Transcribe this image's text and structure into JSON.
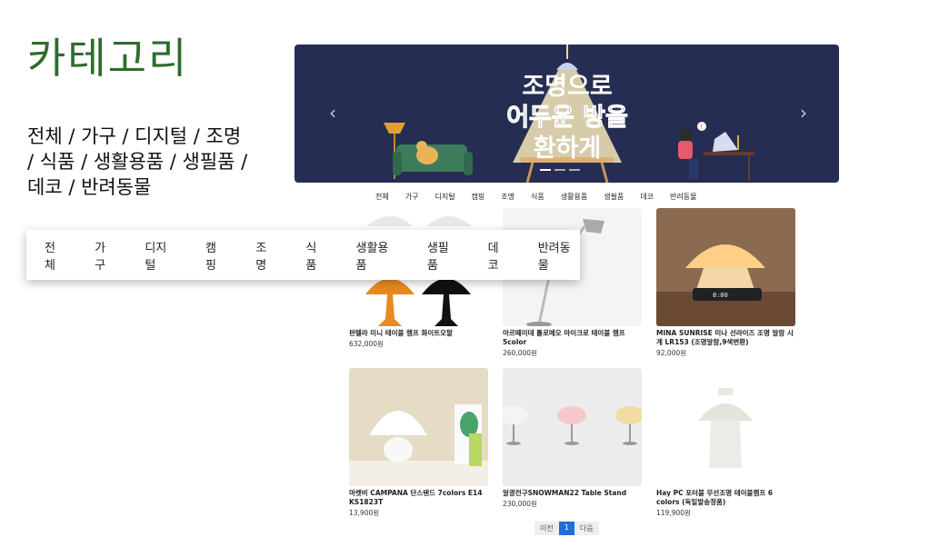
{
  "page_title": "카테고리",
  "category_text": [
    "전체 / 가구 / 디지털 / 조명",
    "/ 식품 / 생활용품 / 생필품 /",
    "데코 / 반려동물"
  ],
  "banner": {
    "line1": "조명으로",
    "line2": "어두운 방을",
    "line3": "환하게",
    "prev_icon": "chevron-left-icon",
    "next_icon": "chevron-right-icon",
    "bg_color": "#262d52"
  },
  "small_categories": [
    "전체",
    "가구",
    "디지털",
    "캠핑",
    "조명",
    "식품",
    "생활용품",
    "생필품",
    "데코",
    "반려동물"
  ],
  "category_bar": [
    "전체",
    "가구",
    "디지털",
    "캠핑",
    "조명",
    "식품",
    "생활용품",
    "생필품",
    "데코",
    "반려동물"
  ],
  "products": [
    {
      "name": "판텔라 미니 테이블 램프 화이트오팔",
      "price": "632,000원"
    },
    {
      "name": "아르떼미데 톨로메오 마이크로 테이블 램프 5color",
      "price": "260,000원"
    },
    {
      "name": "MINA SUNRISE 미나 선라이즈 조명 알람 시계 LR153 (조명알람,9색변환)",
      "price": "92,000원"
    },
    {
      "name": "마켓비 CAMPANA 단스탠드 7colors E14 KS1823T",
      "price": "13,900원"
    },
    {
      "name": "알광전구SNOWMAN22 Table Stand",
      "price": "230,000원"
    },
    {
      "name": "Hay PC 포터블 무선조명 테이블램프 6 colors (독일발송정품)",
      "price": "119,900원"
    }
  ],
  "pager": {
    "prev": "이전",
    "current": "1",
    "next": "다음"
  }
}
